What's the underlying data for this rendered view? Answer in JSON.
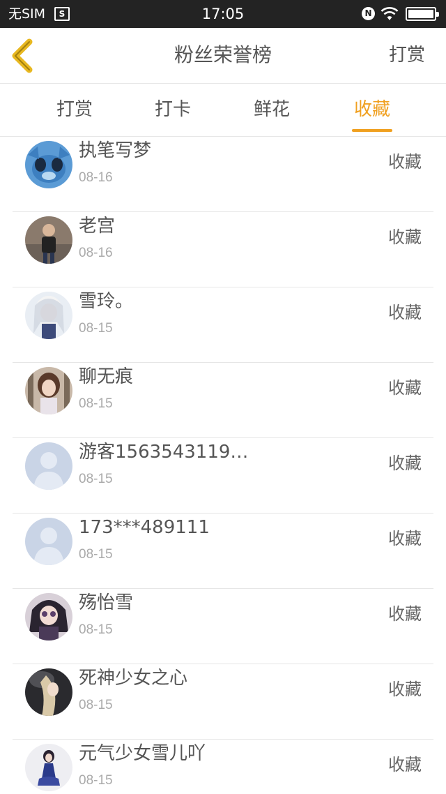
{
  "status_bar": {
    "carrier": "无SIM",
    "time": "17:05"
  },
  "nav": {
    "title": "粉丝荣誉榜",
    "action": "打赏"
  },
  "tabs": [
    {
      "label": "打赏"
    },
    {
      "label": "打卡"
    },
    {
      "label": "鲜花"
    },
    {
      "label": "收藏",
      "active": true
    }
  ],
  "accent_color": "#f0a020",
  "list": [
    {
      "name": "执笔写梦",
      "date": "08-16",
      "action": "收藏"
    },
    {
      "name": "老宫",
      "date": "08-16",
      "action": "收藏"
    },
    {
      "name": "雪玲。",
      "date": "08-15",
      "action": "收藏"
    },
    {
      "name": "聊无痕",
      "date": "08-15",
      "action": "收藏"
    },
    {
      "name": "游客1563543119…",
      "date": "08-15",
      "action": "收藏"
    },
    {
      "name": "173***489111",
      "date": "08-15",
      "action": "收藏"
    },
    {
      "name": "殇怡雪",
      "date": "08-15",
      "action": "收藏"
    },
    {
      "name": "死神少女之心",
      "date": "08-15",
      "action": "收藏"
    },
    {
      "name": "元气少女雪儿吖",
      "date": "08-15",
      "action": "收藏"
    }
  ]
}
